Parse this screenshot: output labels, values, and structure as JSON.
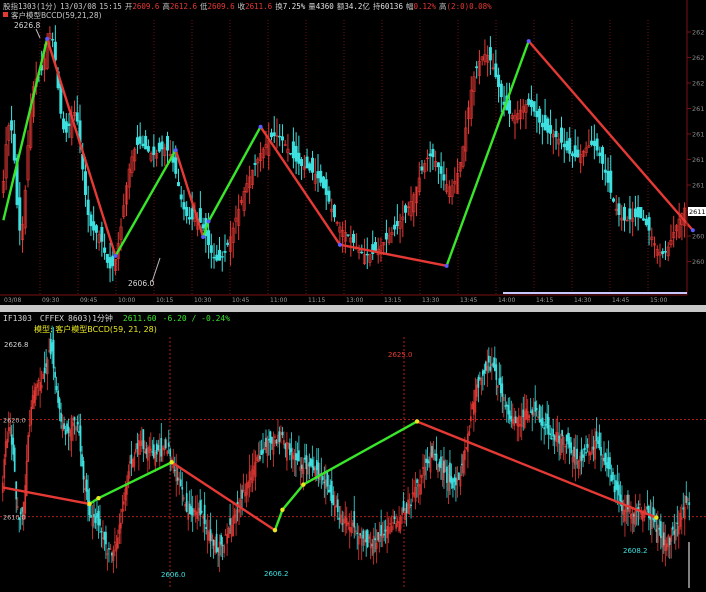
{
  "top": {
    "header": {
      "symbol": "股指1303",
      "period": "(1分)",
      "date": "13/03/08",
      "time": "15:15",
      "open_label": "开",
      "open": "2609.6",
      "high_label": "高",
      "high": "2612.6",
      "low_label": "低",
      "low": "2609.6",
      "close_label": "收",
      "close": "2611.6",
      "turnover_label": "换",
      "turnover": "7.25%",
      "volume_label": "量",
      "volume": "4360",
      "amount_label": "额",
      "amount": "34.2亿",
      "oi_label": "持",
      "oi": "60136",
      "change_label": "幅",
      "change": "0.12%",
      "indicator_value_label": "高",
      "indicator_value": "(2:0)0.08%"
    },
    "model_label": "客户模型BCCD(59,21,28)",
    "annotations": {
      "high_label": "2626.8",
      "low_label": "2606.0"
    },
    "y_ticks": [
      "262",
      "262",
      "262",
      "261",
      "261",
      "261",
      "261",
      "260",
      "260",
      "260"
    ],
    "x_ticks": [
      "03/08",
      "09:30",
      "09:45",
      "10:00",
      "10:15",
      "10:30",
      "10:45",
      "11:00",
      "11:15",
      "13:00",
      "13:15",
      "13:30",
      "13:45",
      "14:00",
      "14:15",
      "14:30",
      "14:45",
      "15:00"
    ],
    "last_price_box": "2611.6",
    "colors": {
      "up": "#e53935",
      "down": "#3ee0e0",
      "zigzag_up": "#39e62a",
      "zigzag_down": "#e53935",
      "grid": "#6e1111",
      "text": "#c8c8c8"
    }
  },
  "bottom": {
    "header": {
      "code": "IF1303",
      "exchange": "CFFEX",
      "label": "8603)1分钟",
      "price": "2611.60",
      "change": "-6.20 / -0.24%"
    },
    "model_line": "模型: 客户模型BCCD(59, 21, 28)",
    "annotations": {
      "high_left": "2626.8",
      "high_mid": "2625.0",
      "low_1": "2606.0",
      "low_2": "2606.2",
      "low_3": "2608.2"
    },
    "y_ticks": [
      "2620.0",
      "2610.0"
    ],
    "colors": {
      "up": "#e53935",
      "down": "#3ee0e0",
      "zigzag_up": "#39e62a",
      "zigzag_down": "#e53935",
      "grid": "#b01c1c",
      "text": "#d4d4d4",
      "pivot": "#e8e820"
    }
  },
  "chart_data": [
    {
      "type": "candlestick",
      "title": "股指1303 (1分)",
      "series_name": "客户模型BCCD(59,21,28)",
      "ylim": [
        2604.5,
        2628.5
      ],
      "zigzag_pivots": [
        {
          "bar": 0,
          "price": 2610.5
        },
        {
          "bar": 16,
          "price": 2626.8
        },
        {
          "bar": 41,
          "price": 2607.3
        },
        {
          "bar": 63,
          "price": 2616.8
        },
        {
          "bar": 73,
          "price": 2609.0
        },
        {
          "bar": 75,
          "price": 2610.4
        },
        {
          "bar": 94,
          "price": 2618.9
        },
        {
          "bar": 123,
          "price": 2608.3
        },
        {
          "bar": 162,
          "price": 2606.4
        },
        {
          "bar": 192,
          "price": 2626.6
        },
        {
          "bar": 252,
          "price": 2609.6
        }
      ],
      "closes": [
        2614.0,
        2617.3,
        2619.0,
        2618.6,
        2615.9,
        2611.9,
        2609.6,
        2610.1,
        2613.2,
        2617.2,
        2620.6,
        2622.5,
        2623.2,
        2623.6,
        2624.0,
        2625.0,
        2626.4,
        2627.3,
        2626.7,
        2624.9,
        2622.4,
        2620.1,
        2618.7,
        2618.4,
        2619.0,
        2619.9,
        2620.2,
        2619.4,
        2617.5,
        2615.1,
        2612.8,
        2611.0,
        2610.0,
        2609.6,
        2609.4,
        2609.2,
        2608.6,
        2607.6,
        2606.7,
        2606.2,
        2606.4,
        2607.0,
        2608.4,
        2609.9,
        2611.8,
        2613.6,
        2615.1,
        2616.2,
        2616.9,
        2617.3,
        2617.4,
        2617.2,
        2616.9,
        2616.7,
        2616.5,
        2616.4,
        2616.5,
        2616.7,
        2616.9,
        2617.0,
        2616.8,
        2616.4,
        2615.7,
        2614.7,
        2613.6,
        2612.4,
        2611.5,
        2610.9,
        2610.6,
        2610.6,
        2610.7,
        2610.6,
        2610.3,
        2609.8,
        2609.1,
        2608.3,
        2607.6,
        2607.1,
        2606.9,
        2606.9,
        2607.2,
        2607.6,
        2608.3,
        2609.0,
        2609.8,
        2610.7,
        2611.5,
        2612.3,
        2613.1,
        2613.8,
        2614.4,
        2615.0,
        2615.5,
        2616.0,
        2616.5,
        2616.9,
        2617.3,
        2617.7,
        2618.0,
        2618.1,
        2618.1,
        2618.0,
        2617.7,
        2617.3,
        2616.9,
        2616.5,
        2616.1,
        2615.8,
        2615.6,
        2615.4,
        2615.3,
        2615.2,
        2615.0,
        2614.8,
        2614.6,
        2614.3,
        2613.9,
        2613.4,
        2612.8,
        2612.2,
        2611.5,
        2610.8,
        2610.3,
        2609.9,
        2609.6,
        2609.4,
        2609.2,
        2608.9,
        2608.5,
        2608.1,
        2607.8,
        2607.6,
        2607.4,
        2607.4,
        2607.4,
        2607.5,
        2607.7,
        2607.9,
        2608.2,
        2608.5,
        2608.8,
        2609.1,
        2609.4,
        2609.7,
        2610.0,
        2610.4,
        2610.8,
        2611.2,
        2611.7,
        2612.2,
        2612.8,
        2613.5,
        2614.3,
        2615.0,
        2615.6,
        2616.1,
        2616.3,
        2616.2,
        2615.8,
        2615.3,
        2614.7,
        2614.1,
        2613.7,
        2613.5,
        2613.6,
        2614.0,
        2614.7,
        2615.7,
        2617.1,
        2618.8,
        2620.6,
        2622.2,
        2623.4,
        2624.2,
        2624.8,
        2625.2,
        2625.4,
        2625.3,
        2624.9,
        2624.2,
        2623.4,
        2622.5,
        2621.6,
        2620.9,
        2620.4,
        2620.1,
        2619.9,
        2619.9,
        2620.1,
        2620.4,
        2620.7,
        2620.9,
        2620.9,
        2620.7,
        2620.3,
        2619.8,
        2619.3,
        2618.9,
        2618.6,
        2618.4,
        2618.3,
        2618.2,
        2618.0,
        2617.8,
        2617.5,
        2617.1,
        2616.8,
        2616.5,
        2616.3,
        2616.2,
        2616.2,
        2616.4,
        2616.7,
        2617.0,
        2617.2,
        2617.3,
        2617.2,
        2616.8,
        2616.3,
        2615.6,
        2614.8,
        2613.9,
        2613.0,
        2612.2,
        2611.5,
        2611.0,
        2610.7,
        2610.5,
        2610.5,
        2610.6,
        2610.7,
        2610.8,
        2610.8,
        2610.7,
        2610.5,
        2610.1,
        2609.6,
        2609.0,
        2608.4,
        2607.9,
        2607.6,
        2607.5,
        2607.7,
        2608.1,
        2608.7,
        2609.4,
        2610.0,
        2610.6,
        2611.1,
        2611.6
      ]
    },
    {
      "type": "candlestick",
      "title": "IF1303 8603)1分钟",
      "series_name": "客户模型BCCD(59, 21, 28)",
      "ylim": [
        2604.5,
        2628.5
      ],
      "zigzag_pivots": [
        {
          "bar": 0,
          "price": 2613.0
        },
        {
          "bar": 58,
          "price": 2611.3
        },
        {
          "bar": 64,
          "price": 2611.9
        },
        {
          "bar": 113,
          "price": 2615.6
        },
        {
          "bar": 182,
          "price": 2608.6
        },
        {
          "bar": 187,
          "price": 2610.7
        },
        {
          "bar": 201,
          "price": 2613.3
        },
        {
          "bar": 277,
          "price": 2619.8
        },
        {
          "bar": 437,
          "price": 2609.9
        }
      ]
    }
  ]
}
